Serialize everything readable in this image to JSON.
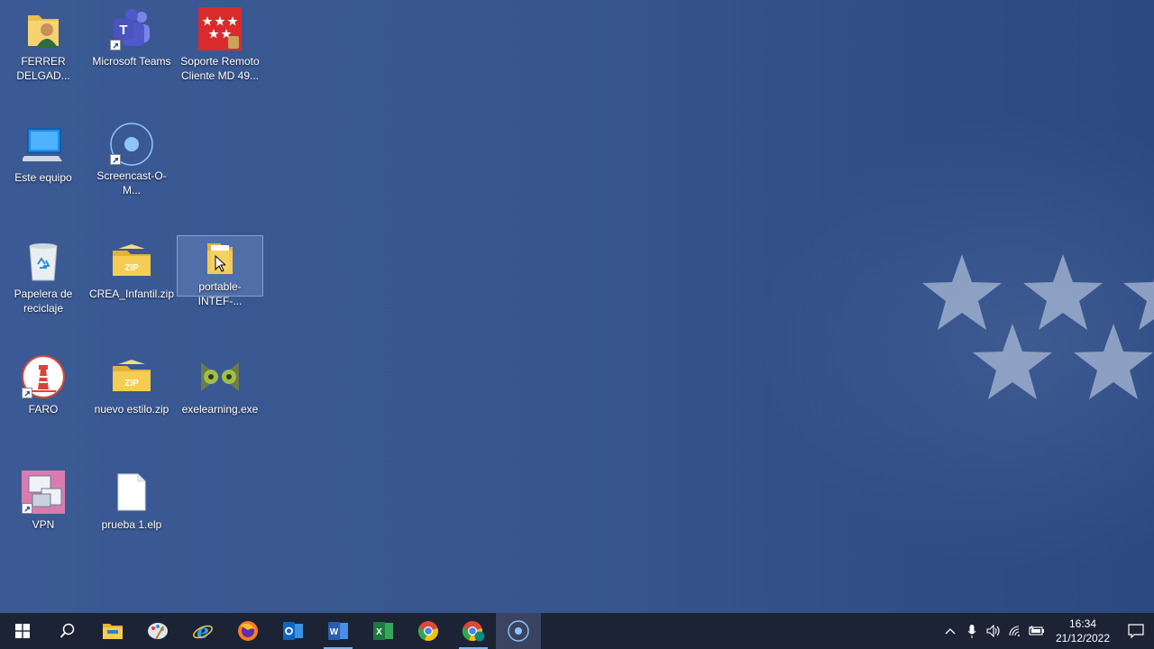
{
  "desktop": {
    "icons": [
      {
        "label": "FERRER\nDELGAD...",
        "icon": "user-folder-icon",
        "shortcut": false
      },
      {
        "label": "Microsoft Teams",
        "icon": "teams-icon",
        "shortcut": true
      },
      {
        "label": "Soporte Remoto\nCliente MD 49...",
        "icon": "madrid-flag-icon",
        "shortcut": false
      },
      {
        "label": "Este equipo",
        "icon": "computer-icon",
        "shortcut": false
      },
      {
        "label": "Screencast-O-M...",
        "icon": "screencast-icon",
        "shortcut": true
      },
      {
        "label": "Papelera de\nreciclaje",
        "icon": "recycle-bin-icon",
        "shortcut": false
      },
      {
        "label": "CREA_Infantil.zip",
        "icon": "zip-folder-icon",
        "shortcut": false
      },
      {
        "label": "portable-INTEF-...",
        "icon": "folder-icon",
        "shortcut": false,
        "selected": true
      },
      {
        "label": "FARO",
        "icon": "lighthouse-icon",
        "shortcut": true
      },
      {
        "label": "nuevo estilo.zip",
        "icon": "zip-folder-icon",
        "shortcut": false
      },
      {
        "label": "exelearning.exe",
        "icon": "exelearning-icon",
        "shortcut": false
      },
      {
        "label": "VPN",
        "icon": "vpn-icon",
        "shortcut": true
      },
      {
        "label": "prueba 1.elp",
        "icon": "document-icon",
        "shortcut": false
      }
    ]
  },
  "taskbar": {
    "buttons": [
      {
        "name": "start-button",
        "icon": "windows-icon"
      },
      {
        "name": "search-button",
        "icon": "search-icon"
      },
      {
        "name": "file-explorer-button",
        "icon": "folder-icon"
      },
      {
        "name": "paint-button",
        "icon": "paint-icon"
      },
      {
        "name": "internet-explorer-button",
        "icon": "internet-explorer-icon"
      },
      {
        "name": "firefox-button",
        "icon": "firefox-icon"
      },
      {
        "name": "outlook-button",
        "icon": "outlook-icon"
      },
      {
        "name": "word-button",
        "icon": "word-icon",
        "running": true
      },
      {
        "name": "excel-button",
        "icon": "excel-icon"
      },
      {
        "name": "chrome-button",
        "icon": "chrome-icon"
      },
      {
        "name": "chrome-profile-button",
        "icon": "chrome-profile-icon",
        "running": true
      },
      {
        "name": "screencast-button",
        "icon": "screencast-icon",
        "active": true
      }
    ],
    "tray": {
      "icons": [
        "chevron-up-icon",
        "microphone-icon",
        "volume-icon",
        "wifi-icon",
        "battery-icon"
      ],
      "time": "16:34",
      "date": "21/12/2022"
    }
  },
  "colors": {
    "desktop": "#37568f",
    "taskbar": "#1b2335",
    "accent": "#7ab1ea"
  }
}
